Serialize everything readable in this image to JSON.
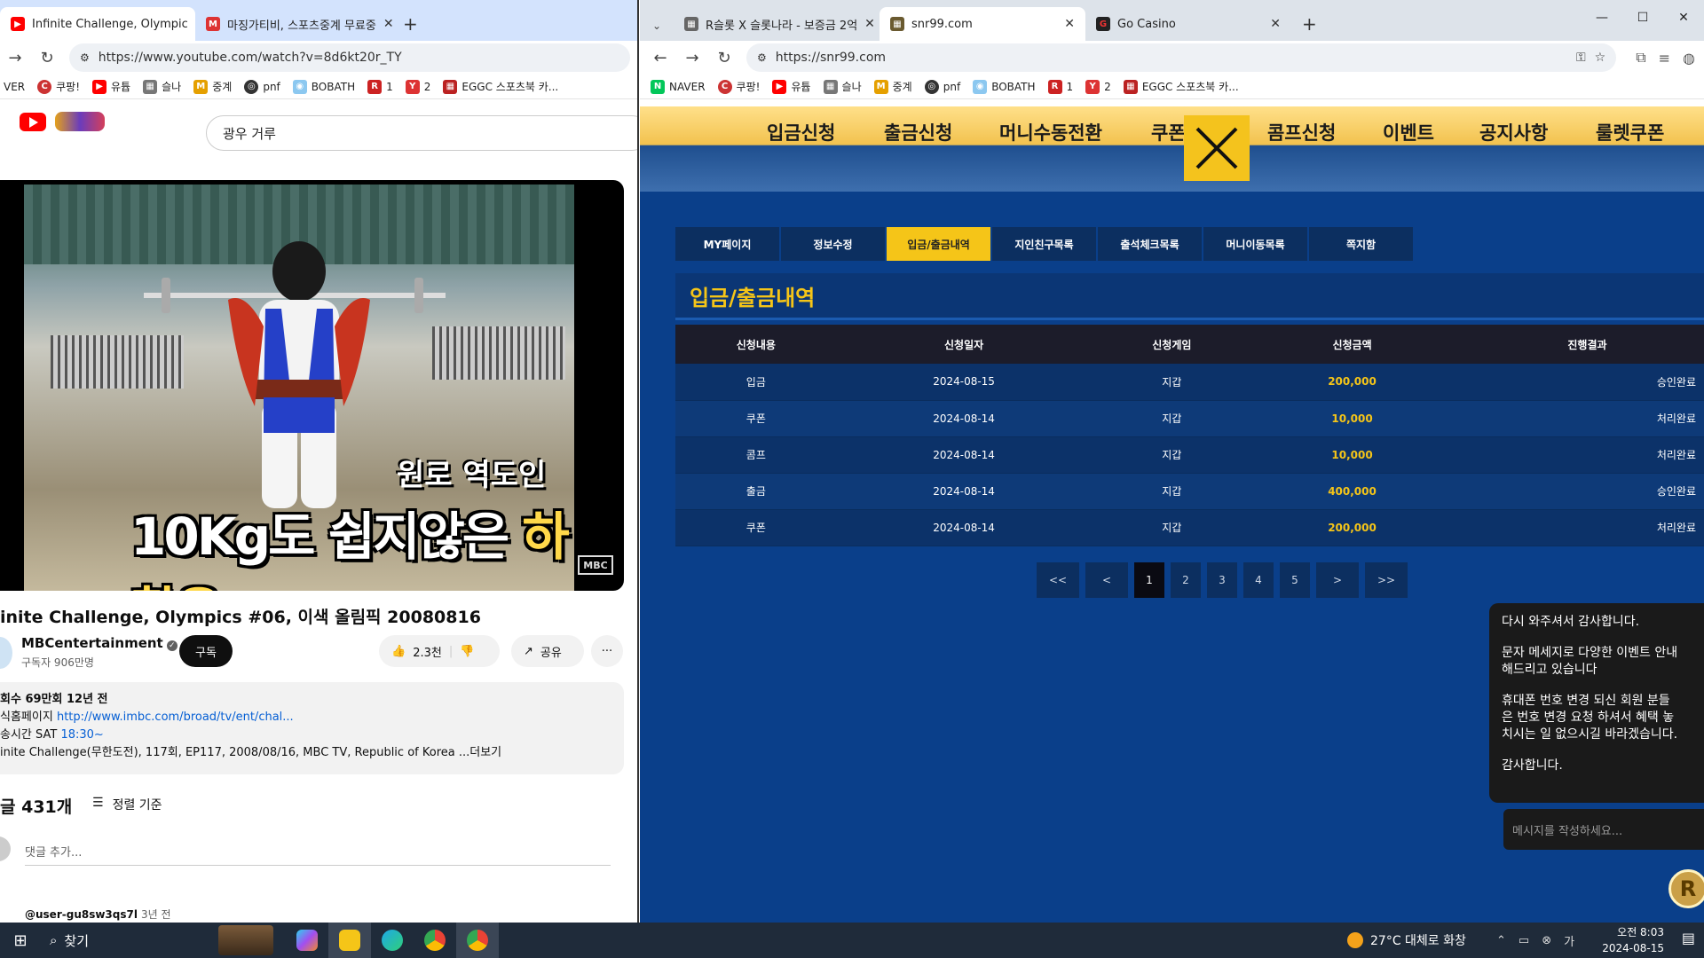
{
  "left_browser": {
    "tabs": [
      {
        "title": "Infinite Challenge, Olympic",
        "active": true
      },
      {
        "title": "마징가티비, 스포츠중계 무료중",
        "active": false
      }
    ],
    "new_tab": "+",
    "url": "https://www.youtube.com/watch?v=8d6kt20r_TY",
    "bookmarks": [
      "VER",
      "쿠팡!",
      "유튭",
      "슬나",
      "중계",
      "pnf",
      "BOBATH",
      "1",
      "2",
      "EGGC 스포츠북 카..."
    ]
  },
  "youtube": {
    "search_value": "광우 거루",
    "video": {
      "subtitle_top": "원로 역도인",
      "subtitle_main_a": "10Kg도 쉽지않은 ",
      "subtitle_main_b": "하찮은",
      "watermark": "MBC"
    },
    "title": "inite Challenge, Olympics #06, 이색 올림픽 20080816",
    "channel_name": "MBCentertainment",
    "subscribers": "구독자 906만명",
    "subscribe_label": "구독",
    "likes": "2.3천",
    "share_label": "공유",
    "more_label": "···",
    "desc_stats": "회수 69만회  12년 전",
    "desc_home_label": "식홈페이지",
    "desc_home_link": "http://www.imbc.com/broad/tv/ent/chal...",
    "desc_air_label": "송시간  SAT ",
    "desc_air_time": "18:30~",
    "desc_line": "inite Challenge(무한도전), 117회, EP117, 2008/08/16, MBC TV, Republic of Korea ...더보기",
    "comments_count": "글 431개",
    "sort_label": "정렬 기준",
    "comment_placeholder": "댓글 추가...",
    "comment_user": "@user-gu8sw3qs7l",
    "comment_time": "3년 전"
  },
  "right_browser": {
    "tabs": [
      {
        "title": "R슬롯 X 슬롯나라 - 보증금 2억",
        "active": false
      },
      {
        "title": "snr99.com",
        "active": true
      },
      {
        "title": "Go Casino",
        "active": false
      }
    ],
    "new_tab": "+",
    "url": "https://snr99.com",
    "bookmarks": [
      "NAVER",
      "쿠팡!",
      "유튭",
      "슬나",
      "중계",
      "pnf",
      "BOBATH",
      "1",
      "2",
      "EGGC 스포츠북 카..."
    ]
  },
  "site": {
    "menu": [
      "입금신청",
      "출금신청",
      "머니수동전환",
      "쿠폰",
      "콤프신청",
      "이벤트",
      "공지사항",
      "룰렛쿠폰"
    ],
    "subnav": [
      "MY페이지",
      "정보수정",
      "입금/출금내역",
      "지인친구목록",
      "출석체크목록",
      "머니이동목록",
      "쪽지함"
    ],
    "subnav_active": 2,
    "page_title": "입금/출금내역",
    "table": {
      "headers": [
        "신청내용",
        "신청일자",
        "신청게임",
        "신청금액",
        "진행결과"
      ],
      "rows": [
        [
          "입금",
          "2024-08-15",
          "지갑",
          "200,000",
          "승인완료"
        ],
        [
          "쿠폰",
          "2024-08-14",
          "지갑",
          "10,000",
          "처리완료"
        ],
        [
          "콤프",
          "2024-08-14",
          "지갑",
          "10,000",
          "처리완료"
        ],
        [
          "출금",
          "2024-08-14",
          "지갑",
          "400,000",
          "승인완료"
        ],
        [
          "쿠폰",
          "2024-08-14",
          "지갑",
          "200,000",
          "처리완료"
        ]
      ]
    },
    "pager": [
      "<<",
      "<",
      "1",
      "2",
      "3",
      "4",
      "5",
      ">",
      ">>"
    ],
    "pager_active": "1",
    "chat_messages": [
      "다시 와주셔서 감사합니다.",
      "문자 메세지로 다양한 이벤트 안내\n해드리고 있습니다",
      "휴대폰 번호 변경 되신 회원 분들\n은 번호 변경 요청 하셔서 혜택 놓\n치시는 일 없으시길 바라겠습니다.",
      "감사합니다."
    ],
    "chat_placeholder": "메시지를 작성하세요...",
    "corner_logo": "R",
    "accent_color": "#f5c518"
  },
  "taskbar": {
    "search_label": "찾기",
    "weather": "27°C  대체로 화창",
    "time": "오전 8:03",
    "date": "2024-08-15"
  }
}
